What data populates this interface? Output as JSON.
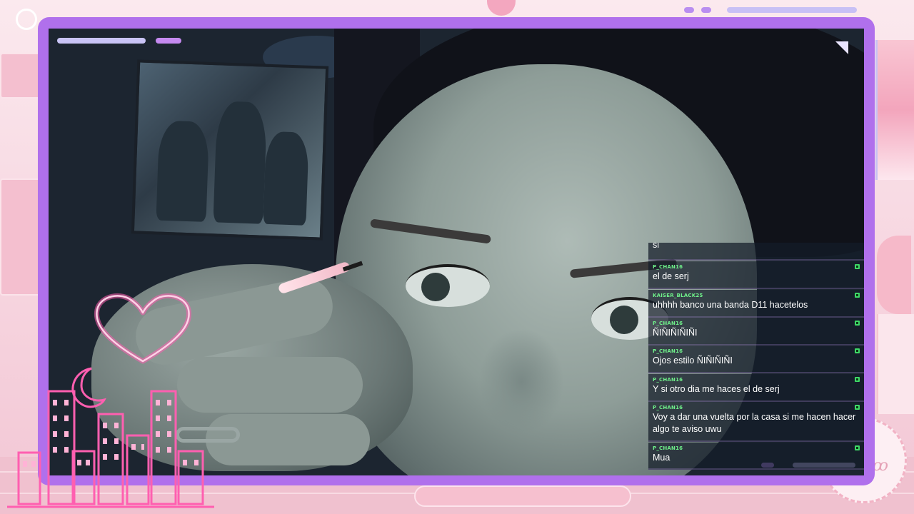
{
  "chat": {
    "partial_message": "si",
    "messages": [
      {
        "user": "P_CHAN16",
        "text": "el de serj"
      },
      {
        "user": "KAISER_BLACK25",
        "text": "uhhhh banco una banda D11 hacetelos"
      },
      {
        "user": "P_CHAN16",
        "text": "ÑIÑIÑIÑIÑI"
      },
      {
        "user": "P_CHAN16",
        "text": "Ojos estilo ÑIÑIÑIÑI"
      },
      {
        "user": "P_CHAN16",
        "text": "Y si otro dia me haces el de serj"
      },
      {
        "user": "P_CHAN16",
        "text": "Voy a dar una vuelta por la casa si me hacen hacer algo te aviso uwu"
      },
      {
        "user": "P_CHAN16",
        "text": "Mua"
      }
    ]
  },
  "overlay": {
    "frame_color": "#b070ec",
    "neon_color": "#ff5fb0",
    "background_color": "#f7dce4",
    "icons": [
      "heart-neon-icon",
      "moon-neon-icon",
      "city-skyline-neon-icon",
      "moderator-badge-icon"
    ]
  }
}
